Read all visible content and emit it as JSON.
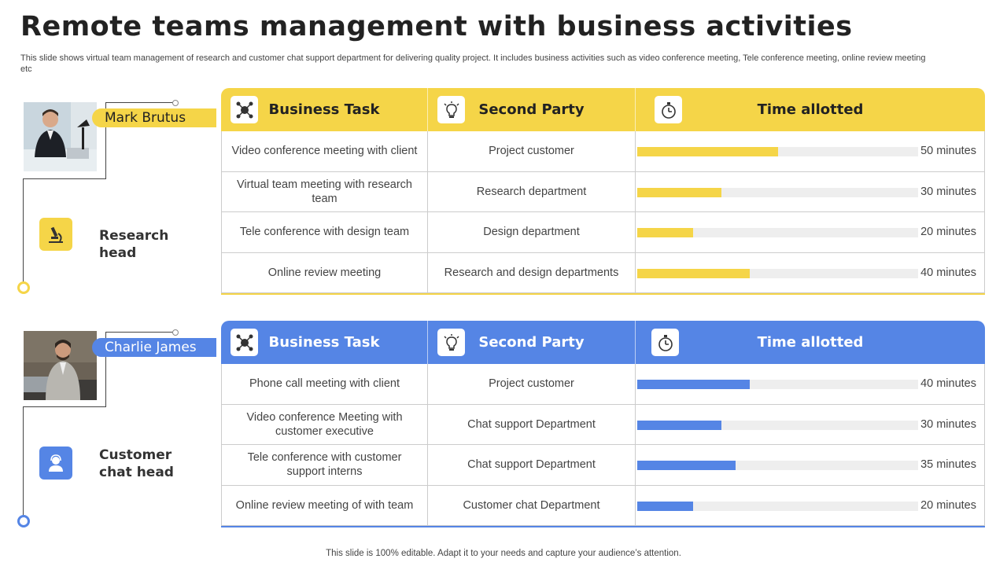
{
  "page": {
    "title": "Remote teams management with business activities",
    "subtitle": "This slide shows virtual team management of research and customer chat support department for delivering quality project. It includes business activities such as video conference meeting, Tele conference meeting, online review meeting etc",
    "footer": "This slide is 100% editable. Adapt it to your needs and capture your audience’s attention."
  },
  "colors": {
    "yellow": "#f5d548",
    "blue": "#5585e5",
    "track": "#eeeeee"
  },
  "teams": [
    {
      "person_name": "Mark Brutus",
      "role": "Research head",
      "role_icon": "microscope-icon",
      "headers": {
        "task": "Business Task",
        "party": "Second Party",
        "time": "Time allotted"
      },
      "rows": [
        {
          "task": "Video conference meeting with client",
          "party": "Project customer",
          "time_label": "50 minutes",
          "minutes": 50
        },
        {
          "task": "Virtual team meeting with research team",
          "party": "Research department",
          "time_label": "30 minutes",
          "minutes": 30
        },
        {
          "task": "Tele conference with design team",
          "party": "Design department",
          "time_label": "20 minutes",
          "minutes": 20
        },
        {
          "task": "Online review meeting",
          "party": "Research and design departments",
          "time_label": "40 minutes",
          "minutes": 40
        }
      ]
    },
    {
      "person_name": "Charlie James",
      "role": "Customer chat head",
      "role_icon": "headset-user-icon",
      "headers": {
        "task": "Business Task",
        "party": "Second Party",
        "time": "Time allotted"
      },
      "rows": [
        {
          "task": "Phone call meeting with client",
          "party": "Project customer",
          "time_label": "40 minutes",
          "minutes": 40
        },
        {
          "task": "Video conference Meeting with customer executive",
          "party": "Chat support Department",
          "time_label": "30 minutes",
          "minutes": 30
        },
        {
          "task": "Tele conference with customer support interns",
          "party": "Chat support Department",
          "time_label": "35 minutes",
          "minutes": 35
        },
        {
          "task": "Online review meeting of with team",
          "party": "Customer chat Department",
          "time_label": "20 minutes",
          "minutes": 20
        }
      ]
    }
  ]
}
